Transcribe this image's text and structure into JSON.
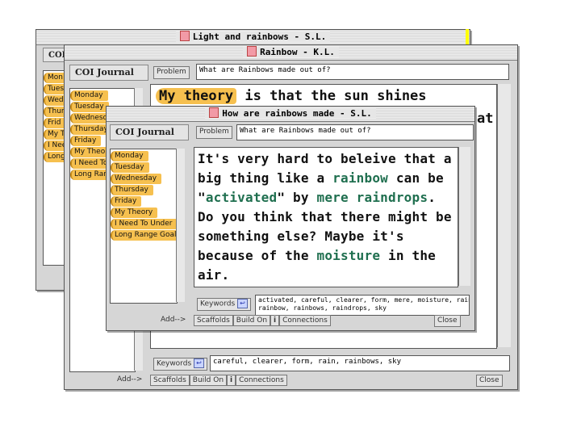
{
  "windows": {
    "back": {
      "title": "Light and  rainbows - S.L.",
      "journal_header": "COI",
      "tags": [
        "Mon",
        "Tues",
        "Wed",
        "Thur",
        "Frid",
        "My T",
        "I Nee",
        "Long"
      ]
    },
    "middle": {
      "title": "Rainbow - K.L.",
      "journal_header": "COI Journal",
      "tags": [
        "Monday",
        "Tuesday",
        "Wednesday",
        "Thursday",
        "Friday",
        "My Theory",
        "I Need To",
        "Long Ran"
      ],
      "problem_label": "Problem",
      "problem_value": "What are Rainbows made out of?",
      "theory_label": "My theory",
      "theory_rest": " is that the sun shines",
      "clipped_text": "at",
      "keywords_label": "Keywords",
      "keywords_value": "careful, clearer, form, rain, rainbows, sky",
      "add_label": "Add-->",
      "bottom_buttons": [
        "Scaffolds",
        "Build On",
        "i",
        "Connections"
      ],
      "close_label": "Close"
    },
    "front": {
      "title": "How are rainbows made - S.L.",
      "journal_header": "COI Journal",
      "tags": [
        "Monday",
        "Tuesday",
        "Wednesday",
        "Thursday",
        "Friday",
        "My Theory",
        "I Need To Under",
        "Long Range Goal"
      ],
      "problem_label": "Problem",
      "problem_value": "What are Rainbows made out of?",
      "body": {
        "p1": "It's very hard to beleive that a big thing like a ",
        "k1": "rainbow",
        "p2": " can be \"",
        "k2": "activated",
        "p3": "\" by ",
        "k3": "mere raindrops",
        "p4": ". Do you think that there might be something else?  Maybe it's because of the ",
        "k4": "moisture",
        "p5": " in the air."
      },
      "keywords_label": "Keywords",
      "keywords_line1": "activated, careful, clearer, form, mere, moisture, rain,",
      "keywords_line2": "rainbow, rainbows, raindrops, sky",
      "add_label": "Add-->",
      "bottom_buttons": [
        "Scaffolds",
        "Build On",
        "i",
        "Connections"
      ],
      "close_label": "Close"
    }
  },
  "colors": {
    "tag": "#f6c04f",
    "keyword_green": "#1f6f4f"
  }
}
